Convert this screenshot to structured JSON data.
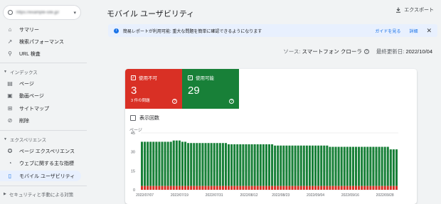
{
  "sidebar": {
    "property": "https://example-site.jp/",
    "items_top": [
      {
        "label": "サマリー",
        "icon": "home-icon"
      },
      {
        "label": "検索パフォーマンス",
        "icon": "trend-icon"
      },
      {
        "label": "URL 検査",
        "icon": "search-icon"
      }
    ],
    "index_section": "インデックス",
    "index_items": [
      {
        "label": "ページ",
        "icon": "page-icon"
      },
      {
        "label": "動画ページ",
        "icon": "video-icon"
      },
      {
        "label": "サイトマップ",
        "icon": "sitemap-icon"
      },
      {
        "label": "削除",
        "icon": "eye-off-icon"
      }
    ],
    "experience_section": "エクスペリエンス",
    "experience_items": [
      {
        "label": "ページ エクスペリエンス",
        "icon": "star-icon"
      },
      {
        "label": "ウェブに関する主な指標",
        "icon": "gauge-icon"
      },
      {
        "label": "モバイル ユーザビリティ",
        "icon": "phone-icon",
        "active": true
      }
    ],
    "security_section": "セキュリティと手動による対策"
  },
  "header": {
    "title": "モバイル ユーザビリティ",
    "export_label": "エクスポート"
  },
  "info_bar": {
    "message": "簡易レポートが利用可能: 重大な問題を簡単に確認できるようになります",
    "guide_link": "ガイドを見る",
    "details_link": "詳細",
    "close": "✕"
  },
  "meta": {
    "source_label": "ソース:",
    "source_value": "スマートフォン クローラ",
    "updated_label": "最終更新日:",
    "updated_value": "2022/10/04"
  },
  "tiles": {
    "unusable_label": "使用不可",
    "unusable_count": "3",
    "unusable_sub": "3 件の問題",
    "usable_label": "使用可能",
    "usable_count": "29"
  },
  "impressions_label": "表示回数",
  "colors": {
    "bad": "#d93025",
    "good": "#188038",
    "accent": "#1a73e8"
  },
  "chart_data": {
    "type": "bar",
    "stacked": true,
    "ylabel": "ページ",
    "ylim": [
      0,
      45
    ],
    "yticks": [
      0,
      15,
      30,
      45
    ],
    "xtick_labels": [
      "2022/07/07",
      "2022/07/19",
      "2022/07/31",
      "2022/08/12",
      "2022/08/23",
      "2022/09/04",
      "2022/09/16",
      "2022/09/28"
    ],
    "start_date": "2022/07/06",
    "series": [
      {
        "name": "使用不可",
        "color": "#d93025",
        "values": [
          3,
          3,
          3,
          3,
          3,
          3,
          3,
          3,
          3,
          3,
          3,
          3,
          3,
          3,
          3,
          3,
          3,
          3,
          3,
          3,
          3,
          3,
          3,
          3,
          3,
          3,
          3,
          3,
          3,
          3,
          3,
          3,
          3,
          3,
          3,
          3,
          3,
          3,
          3,
          3,
          3,
          3,
          3,
          3,
          3,
          3,
          3,
          3,
          3,
          3,
          3,
          3,
          3,
          3,
          3,
          3,
          3,
          3,
          3,
          3,
          3,
          3,
          3,
          3,
          3,
          3,
          3,
          3,
          3,
          3,
          3,
          3,
          3,
          3,
          3,
          3,
          3,
          3,
          3,
          3,
          3,
          3,
          3,
          3,
          3,
          3,
          3,
          3,
          3
        ]
      },
      {
        "name": "使用可能",
        "color": "#188038",
        "values": [
          35,
          35,
          35,
          35,
          35,
          35,
          35,
          35,
          35,
          35,
          35,
          36,
          36,
          36,
          35,
          35,
          34,
          34,
          34,
          34,
          34,
          34,
          34,
          34,
          34,
          34,
          34,
          34,
          34,
          34,
          33,
          33,
          33,
          33,
          33,
          33,
          33,
          33,
          33,
          33,
          33,
          33,
          33,
          33,
          33,
          33,
          32,
          32,
          32,
          32,
          32,
          32,
          32,
          32,
          32,
          32,
          32,
          32,
          32,
          32,
          32,
          32,
          32,
          32,
          32,
          31,
          31,
          31,
          31,
          31,
          31,
          31,
          31,
          31,
          31,
          31,
          31,
          31,
          31,
          31,
          31,
          31,
          31,
          31,
          31,
          31,
          29,
          29,
          29
        ]
      }
    ]
  }
}
